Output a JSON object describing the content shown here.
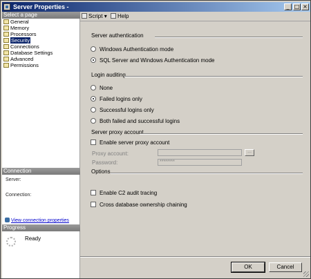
{
  "window": {
    "title": "Server Properties -",
    "min": "_",
    "max": "□",
    "close": "×"
  },
  "left": {
    "select_page_header": "Select a page",
    "pages": [
      "General",
      "Memory",
      "Processors",
      "Security",
      "Connections",
      "Database Settings",
      "Advanced",
      "Permissions"
    ],
    "selected_index": 3,
    "connection_header": "Connection",
    "server_label": "Server:",
    "connection_label": "Connection:",
    "view_link": "View connection properties",
    "progress_header": "Progress",
    "progress_status": "Ready"
  },
  "toolbar": {
    "script": "Script",
    "script_dropdown": "▾",
    "help": "Help"
  },
  "security": {
    "server_auth_title": "Server authentication",
    "auth_options": [
      "Windows Authentication mode",
      "SQL Server and Windows Authentication mode"
    ],
    "auth_selected": 1,
    "login_audit_title": "Login auditing",
    "audit_options": [
      "None",
      "Failed logins only",
      "Successful logins only",
      "Both failed and successful logins"
    ],
    "audit_selected": 1,
    "proxy_title": "Server proxy account",
    "enable_proxy_label": "Enable server proxy account",
    "proxy_account_label": "Proxy account:",
    "proxy_account_value": "",
    "browse_label": "...",
    "password_label": "Password:",
    "password_value": "********",
    "options_title": "Options",
    "option_checks": [
      "Enable C2 audit tracing",
      "Cross database ownership chaining"
    ]
  },
  "buttons": {
    "ok": "OK",
    "cancel": "Cancel"
  }
}
